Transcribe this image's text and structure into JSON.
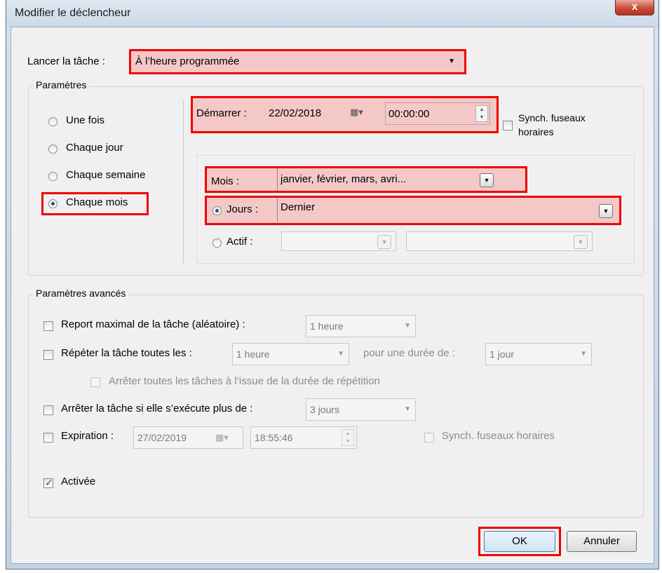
{
  "window": {
    "title": "Modifier le déclencheur",
    "close_label": "x"
  },
  "launch": {
    "label": "Lancer la tâche :",
    "value": "À l’heure programmée"
  },
  "parametres": {
    "title": "Paramètres",
    "frequency_options": [
      {
        "label": "Une fois",
        "checked": false
      },
      {
        "label": "Chaque jour",
        "checked": false
      },
      {
        "label": "Chaque semaine",
        "checked": false
      },
      {
        "label": "Chaque mois",
        "checked": true
      }
    ],
    "start": {
      "label": "Démarrer :",
      "date": "22/02/2018",
      "time": "00:00:00"
    },
    "sync": {
      "line1": "Synch. fuseaux",
      "line2": "horaires"
    },
    "months": {
      "label": "Mois :",
      "value": "janvier, février, mars, avri..."
    },
    "days": {
      "label": "Jours :",
      "value": "Dernier"
    },
    "active": {
      "label": "Actif :",
      "value1": "",
      "value2": ""
    }
  },
  "advanced": {
    "title": "Paramètres avancés",
    "delay": {
      "label": "Report maximal de la tâche (aléatoire) :",
      "value": "1 heure"
    },
    "repeat": {
      "label": "Répéter la tâche toutes les :",
      "value": "1 heure",
      "duration_label": "pour une durée de :",
      "duration_value": "1 jour"
    },
    "stop_all": {
      "label": "Arrêter toutes les tâches à l’issue de la durée de répétition"
    },
    "stop_if": {
      "label": "Arrêter la tâche si elle s’exécute plus de :",
      "value": "3 jours"
    },
    "expiration": {
      "label": "Expiration :",
      "date": "27/02/2019",
      "time": "18:55:46",
      "sync_label": "Synch. fuseaux horaires"
    },
    "enabled": {
      "label": "Activée"
    }
  },
  "buttons": {
    "ok": "OK",
    "cancel": "Annuler"
  }
}
